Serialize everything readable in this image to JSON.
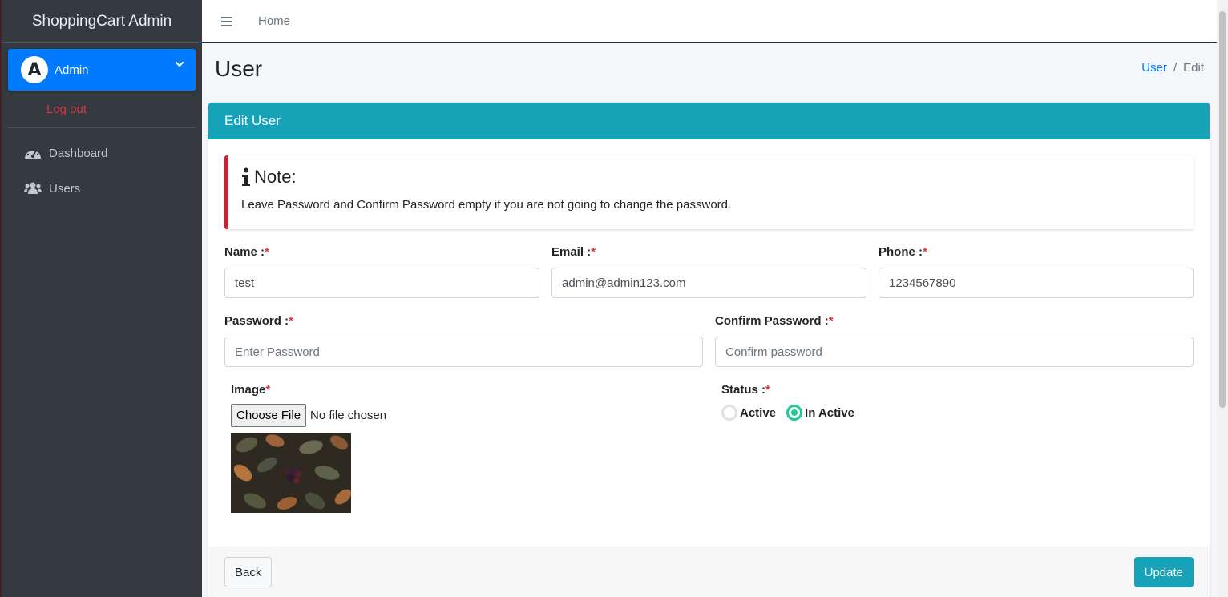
{
  "app": {
    "brand": "ShoppingCart Admin"
  },
  "sidebar": {
    "user_initial": "A",
    "user_name": "Admin",
    "logout_label": "Log out",
    "items": [
      {
        "label": "Dashboard",
        "icon": "tachometer-icon"
      },
      {
        "label": "Users",
        "icon": "users-icon"
      }
    ]
  },
  "topbar": {
    "home_label": "Home"
  },
  "page": {
    "title": "User",
    "breadcrumb": {
      "link": "User",
      "separator": "/",
      "current": "Edit"
    }
  },
  "card": {
    "header": "Edit User",
    "note": {
      "title": "Note:",
      "text": "Leave Password and Confirm Password empty if you are not going to change the password."
    },
    "fields": {
      "name": {
        "label": "Name :",
        "required": "*",
        "value": "test"
      },
      "email": {
        "label": "Email :",
        "required": "*",
        "value": "admin@admin123.com"
      },
      "phone": {
        "label": "Phone :",
        "required": "*",
        "value": "1234567890"
      },
      "password": {
        "label": "Password :",
        "required": "*",
        "placeholder": "Enter Password"
      },
      "confirm_password": {
        "label": "Confirm Password :",
        "required": "*",
        "placeholder": "Confirm password"
      },
      "image": {
        "label": "Image",
        "required": "*",
        "button": "Choose File",
        "file_text": "No file chosen"
      },
      "status": {
        "label": "Status :",
        "required": "*",
        "options": [
          "Active",
          "In Active"
        ],
        "selected": "In Active"
      }
    },
    "footer": {
      "back_label": "Back",
      "update_label": "Update"
    }
  },
  "colors": {
    "sidebar_bg": "#343a40",
    "primary": "#007bff",
    "info": "#17a2b8",
    "danger": "#dc3545",
    "radio_checked": "#20c997"
  }
}
